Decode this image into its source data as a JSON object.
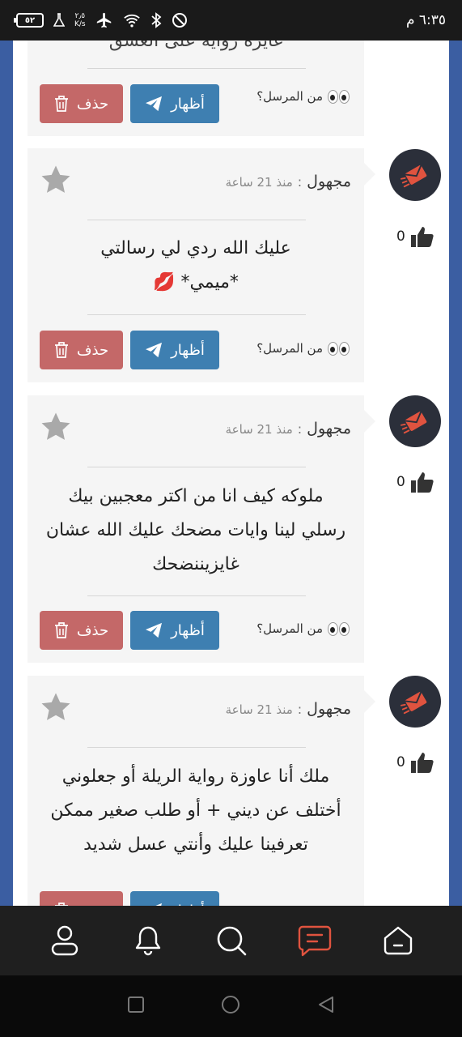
{
  "status_bar": {
    "time": "٦:٣٥ م",
    "battery": "٥٢",
    "speed_value": "٢٫٥",
    "speed_unit": "K/s"
  },
  "labels": {
    "from_sender": "من المرسل؟",
    "show_button": "أظهار",
    "delete_button": "حذف",
    "colon": ":"
  },
  "messages": [
    {
      "sender": "",
      "time": "",
      "text": "غايزة رواية على العشق",
      "likes": ""
    },
    {
      "sender": "مجهول",
      "time": "منذ 21 ساعة",
      "text_lines": [
        "عليك الله ردي لي رسالتي",
        "*ميمي* 💋"
      ],
      "likes": "0"
    },
    {
      "sender": "مجهول",
      "time": "منذ 21 ساعة",
      "text_lines": [
        "ملوكه كيف انا من اكتر معجبين بيك",
        "رسلي لينا وايات مضحك عليك الله عشان",
        "غايزيننضحك"
      ],
      "likes": "0"
    },
    {
      "sender": "مجهول",
      "time": "منذ 21 ساعة",
      "text_lines": [
        "ملك أنا عاوزة رواية الريلة أو جعلوني",
        "أختلف عن ديني + أو طلب صغير ممكن",
        "تعرفينا عليك وأنتي عسل شديد"
      ],
      "likes": "0"
    }
  ],
  "colors": {
    "show_button": "#3e7fb1",
    "delete_button": "#c46868",
    "side_bar": "#3b5ea2",
    "avatar_bg": "#2b2f3a",
    "avatar_icon": "#e0533f",
    "nav_active": "#e0533f"
  },
  "icons": {
    "nav": [
      "profile-icon",
      "bell-icon",
      "search-icon",
      "messages-icon",
      "home-icon"
    ],
    "system": [
      "recents-icon",
      "home-circle-icon",
      "back-icon"
    ]
  }
}
